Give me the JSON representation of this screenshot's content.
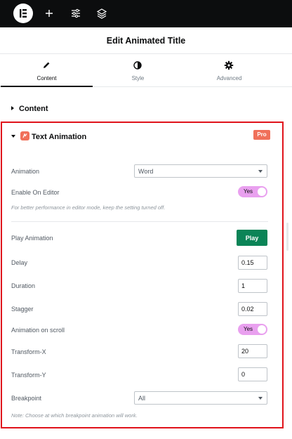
{
  "topbar": {
    "icons": [
      "elementor-logo-icon",
      "plus-icon",
      "sliders-icon",
      "layers-icon"
    ]
  },
  "header": {
    "title": "Edit Animated Title"
  },
  "tabs": [
    {
      "label": "Content",
      "icon": "pencil-icon",
      "active": true
    },
    {
      "label": "Style",
      "icon": "half-circle-icon",
      "active": false
    },
    {
      "label": "Advanced",
      "icon": "gear-icon",
      "active": false
    }
  ],
  "content_section": {
    "title": "Content"
  },
  "text_animation": {
    "title": "Text Animation",
    "badge": "Pro",
    "highlight_color": "#e0131b",
    "animation_label": "Animation",
    "animation_value": "Word",
    "enable_editor_label": "Enable On Editor",
    "enable_editor_toggle": "Yes",
    "editor_note": "For better performance in editor mode, keep the setting turned off.",
    "play_label": "Play Animation",
    "play_button": "Play",
    "delay_label": "Delay",
    "delay_value": "0.15",
    "duration_label": "Duration",
    "duration_value": "1",
    "stagger_label": "Stagger",
    "stagger_value": "0.02",
    "scroll_label": "Animation on scroll",
    "scroll_toggle": "Yes",
    "transform_x_label": "Transform-X",
    "transform_x_value": "20",
    "transform_y_label": "Transform-Y",
    "transform_y_value": "0",
    "breakpoint_label": "Breakpoint",
    "breakpoint_value": "All",
    "breakpoint_note": "Note: Choose at which breakpoint animation will work."
  },
  "colors": {
    "topbar": "#0c0d0e",
    "toggle_on": "#e9a0ef",
    "play_button": "#0b8457",
    "pro_badge": "#f0705a"
  }
}
